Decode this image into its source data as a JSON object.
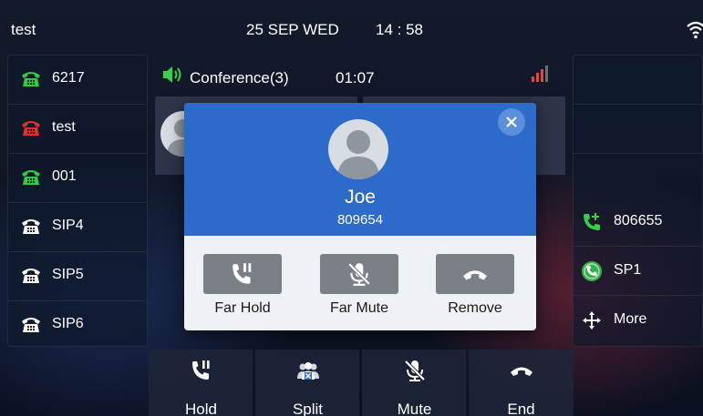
{
  "status_bar": {
    "user": "test",
    "date": "25 SEP WED",
    "time": "14 : 58",
    "wifi_icon": "wifi-icon"
  },
  "lines": [
    {
      "label": "6217",
      "icon": "phone-icon",
      "color": "#2ecc40"
    },
    {
      "label": "test",
      "icon": "phone-icon",
      "color": "#e0302a"
    },
    {
      "label": "001",
      "icon": "phone-icon",
      "color": "#2ecc40"
    },
    {
      "label": "SIP4",
      "icon": "phone-icon",
      "color": "#ffffff"
    },
    {
      "label": "SIP5",
      "icon": "phone-icon",
      "color": "#ffffff"
    },
    {
      "label": "SIP6",
      "icon": "phone-icon",
      "color": "#ffffff"
    }
  ],
  "conference": {
    "title": "Conference(3)",
    "timer": "01:07",
    "speaker_icon": "speakerphone-icon",
    "signal_icon": "signal-icon"
  },
  "right_panel": [
    {
      "label": "806655",
      "icon": "call-add-icon"
    },
    {
      "label": "SP1",
      "icon": "sp-icon"
    },
    {
      "label": "More",
      "icon": "move-icon"
    }
  ],
  "popup": {
    "name": "Joe",
    "number": "809654",
    "actions": [
      {
        "label": "Far Hold",
        "icon": "hold-icon"
      },
      {
        "label": "Far Mute",
        "icon": "mute-icon"
      },
      {
        "label": "Remove",
        "icon": "hangup-icon"
      }
    ]
  },
  "softkeys": [
    {
      "label": "Hold",
      "icon": "hold-icon"
    },
    {
      "label": "Split",
      "icon": "split-icon"
    },
    {
      "label": "Mute",
      "icon": "mute-icon"
    },
    {
      "label": "End",
      "icon": "hangup-icon"
    }
  ],
  "colors": {
    "popup_blue": "#2c6bc9",
    "line_green": "#2ecc40",
    "line_red": "#e0302a",
    "signal_red": "#e0483a"
  }
}
